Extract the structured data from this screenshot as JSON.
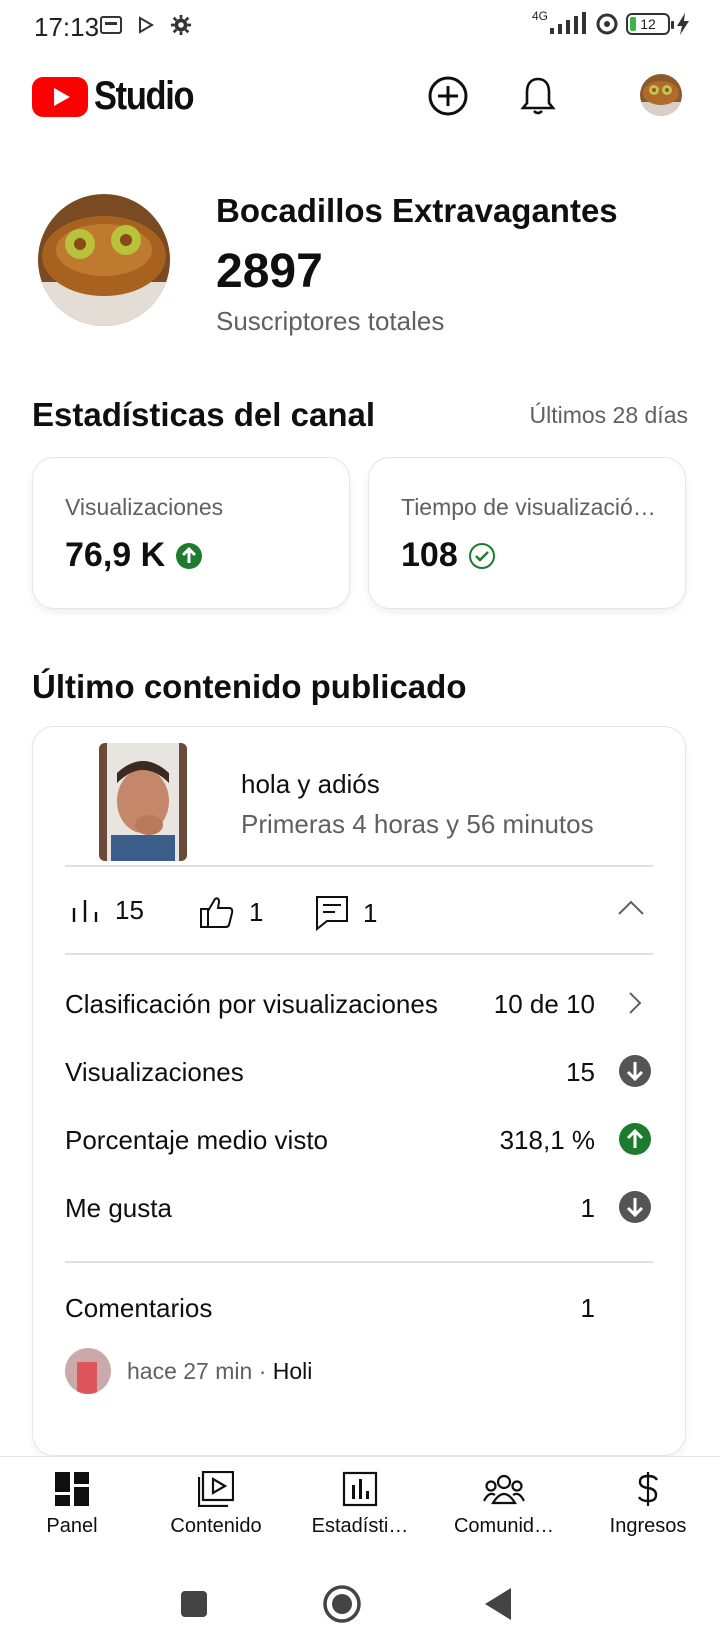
{
  "status_bar": {
    "time": "17:13",
    "network": "4G",
    "battery": "12"
  },
  "app": {
    "logo_text": "Studio"
  },
  "channel": {
    "name": "Bocadillos Extravagantes",
    "subscribers": "2897",
    "subscribers_label": "Suscriptores totales"
  },
  "stats": {
    "title": "Estadísticas del canal",
    "period": "Últimos 28 días",
    "cards": [
      {
        "label": "Visualizaciones",
        "value": "76,9 K",
        "trend": "up"
      },
      {
        "label": "Tiempo de visualización (horas)",
        "value": "108",
        "trend": "check"
      }
    ]
  },
  "latest": {
    "title": "Último contenido publicado",
    "video_title": "hola y adiós",
    "video_subtitle": "Primeras 4 horas y 56 minutos",
    "metrics": {
      "views": "15",
      "likes": "1",
      "comments": "1"
    },
    "details": [
      {
        "name": "Clasificación por visualizaciones",
        "value": "10 de 10",
        "trail": "chevron-right"
      },
      {
        "name": "Visualizaciones",
        "value": "15",
        "trail": "down"
      },
      {
        "name": "Porcentaje medio visto",
        "value": "318,1 %",
        "trail": "up"
      },
      {
        "name": "Me gusta",
        "value": "1",
        "trail": "down"
      }
    ],
    "comments_label": "Comentarios",
    "comments_count": "1",
    "comment": {
      "meta": "hace 27 min · ",
      "text": "Holi"
    }
  },
  "bottom_nav": [
    {
      "label": "Panel",
      "icon": "dashboard-icon"
    },
    {
      "label": "Contenido",
      "icon": "content-icon"
    },
    {
      "label": "Estadísti…",
      "icon": "analytics-icon"
    },
    {
      "label": "Comunid…",
      "icon": "community-icon"
    },
    {
      "label": "Ingresos",
      "icon": "earn-icon"
    }
  ],
  "colors": {
    "brand_red": "#ff0000",
    "trend_up": "#1e7b2e",
    "trend_down": "#555555",
    "text_secondary": "#606060"
  }
}
